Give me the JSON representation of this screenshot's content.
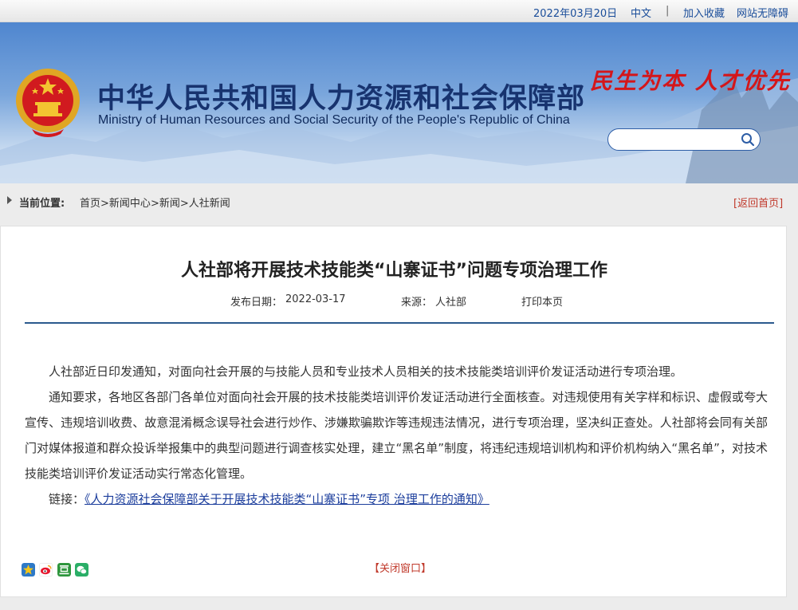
{
  "topbar": {
    "date": "2022年03月20日",
    "lang": "中文",
    "separator": "|",
    "favorite": "加入收藏",
    "accessibility": "网站无障碍"
  },
  "banner": {
    "title_cn": "中华人民共和国人力资源和社会保障部",
    "title_en": "Ministry of Human Resources and Social Security of the People's Republic of China",
    "slogan": "民生为本 人才优先",
    "search_placeholder": ""
  },
  "breadcrumb": {
    "label": "当前位置:",
    "items": [
      "首页",
      "新闻中心",
      "新闻",
      "人社新闻"
    ],
    "sep": ">",
    "back": "[返回首页]"
  },
  "article": {
    "title": "人社部将开展技术技能类“山寨证书”问题专项治理工作",
    "publish_label": "发布日期：",
    "publish_date": "2022-03-17",
    "source_label": "来源：",
    "source": "人社部",
    "print": "打印本页",
    "paragraphs": [
      "人社部近日印发通知，对面向社会开展的与技能人员和专业技术人员相关的技术技能类培训评价发证活动进行专项治理。",
      "通知要求，各地区各部门各单位对面向社会开展的技术技能类培训评价发证活动进行全面核查。对违规使用有关字样和标识、虚假或夸大宣传、违规培训收费、故意混淆概念误导社会进行炒作、涉嫌欺骗欺诈等违规违法情况，进行专项治理，坚决纠正查处。人社部将会同有关部门对媒体报道和群众投诉举报集中的典型问题进行调查核实处理，建立“黑名单”制度，将违纪违规培训机构和评价机构纳入“黑名单”，对技术技能类培训评价发证活动实行常态化管理。"
    ],
    "link_label": "链接：",
    "link_text": "《人力资源社会保障部关于开展技术技能类“山寨证书”专项 治理工作的通知》",
    "close": "【关闭窗口】"
  },
  "colors": {
    "accent_blue": "#17336f",
    "slogan_red": "#d4161a",
    "link_red": "#c0392b",
    "divider": "#2b5a8e"
  },
  "share_icons": [
    "qzone-icon",
    "weibo-icon",
    "douban-icon",
    "wechat-icon"
  ]
}
